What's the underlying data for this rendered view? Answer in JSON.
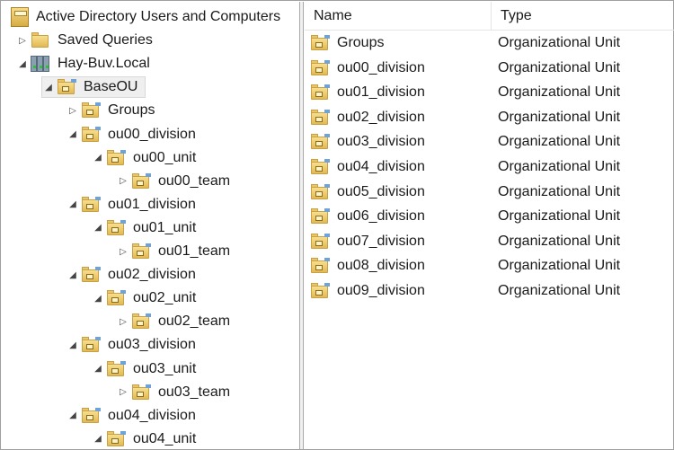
{
  "tree": [
    {
      "label": "Active Directory Users and Computers",
      "level": 0,
      "toggle": "",
      "icon": "console"
    },
    {
      "label": "Saved Queries",
      "level": 1,
      "toggle": "collapsed",
      "icon": "folder"
    },
    {
      "label": "Hay-Buv.Local",
      "level": 1,
      "toggle": "expanded",
      "icon": "domain"
    },
    {
      "label": "BaseOU",
      "level": 2,
      "toggle": "expanded",
      "icon": "ou",
      "selected": true
    },
    {
      "label": "Groups",
      "level": 3,
      "toggle": "collapsed",
      "icon": "ou"
    },
    {
      "label": "ou00_division",
      "level": 3,
      "toggle": "expanded",
      "icon": "ou"
    },
    {
      "label": "ou00_unit",
      "level": 4,
      "toggle": "expanded",
      "icon": "ou"
    },
    {
      "label": "ou00_team",
      "level": 5,
      "toggle": "collapsed",
      "icon": "ou"
    },
    {
      "label": "ou01_division",
      "level": 3,
      "toggle": "expanded",
      "icon": "ou"
    },
    {
      "label": "ou01_unit",
      "level": 4,
      "toggle": "expanded",
      "icon": "ou"
    },
    {
      "label": "ou01_team",
      "level": 5,
      "toggle": "collapsed",
      "icon": "ou"
    },
    {
      "label": "ou02_division",
      "level": 3,
      "toggle": "expanded",
      "icon": "ou"
    },
    {
      "label": "ou02_unit",
      "level": 4,
      "toggle": "expanded",
      "icon": "ou"
    },
    {
      "label": "ou02_team",
      "level": 5,
      "toggle": "collapsed",
      "icon": "ou"
    },
    {
      "label": "ou03_division",
      "level": 3,
      "toggle": "expanded",
      "icon": "ou"
    },
    {
      "label": "ou03_unit",
      "level": 4,
      "toggle": "expanded",
      "icon": "ou"
    },
    {
      "label": "ou03_team",
      "level": 5,
      "toggle": "collapsed",
      "icon": "ou"
    },
    {
      "label": "ou04_division",
      "level": 3,
      "toggle": "expanded",
      "icon": "ou"
    },
    {
      "label": "ou04_unit",
      "level": 4,
      "toggle": "expanded",
      "icon": "ou"
    }
  ],
  "list": {
    "columns": {
      "name": "Name",
      "type": "Type"
    },
    "rows": [
      {
        "name": "Groups",
        "type": "Organizational Unit"
      },
      {
        "name": "ou00_division",
        "type": "Organizational Unit"
      },
      {
        "name": "ou01_division",
        "type": "Organizational Unit"
      },
      {
        "name": "ou02_division",
        "type": "Organizational Unit"
      },
      {
        "name": "ou03_division",
        "type": "Organizational Unit"
      },
      {
        "name": "ou04_division",
        "type": "Organizational Unit"
      },
      {
        "name": "ou05_division",
        "type": "Organizational Unit"
      },
      {
        "name": "ou06_division",
        "type": "Organizational Unit"
      },
      {
        "name": "ou07_division",
        "type": "Organizational Unit"
      },
      {
        "name": "ou08_division",
        "type": "Organizational Unit"
      },
      {
        "name": "ou09_division",
        "type": "Organizational Unit"
      }
    ]
  }
}
